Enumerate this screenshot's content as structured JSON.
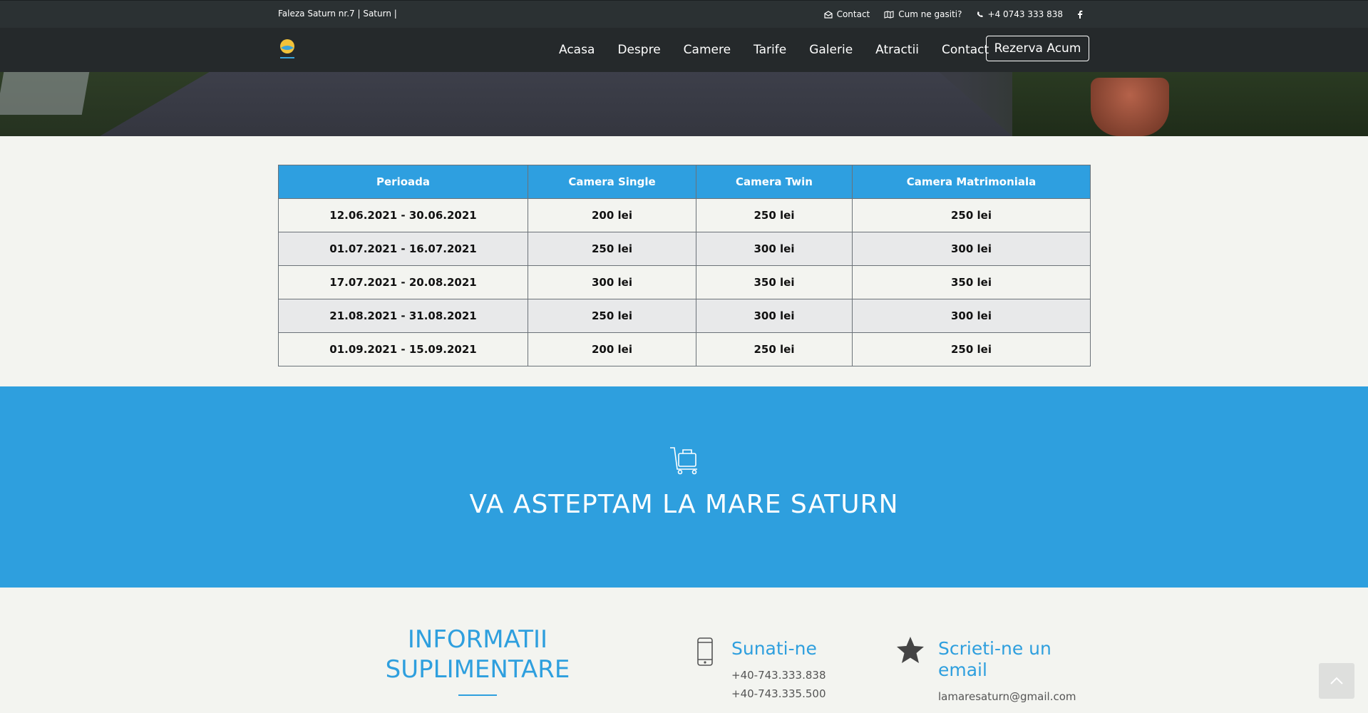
{
  "topbar": {
    "address": "Faleza Saturn nr.7 | Saturn |",
    "contact_label": "Contact",
    "directions_label": "Cum ne gasiti?",
    "phone_label": "+4 0743 333 838"
  },
  "nav": {
    "items": [
      "Acasa",
      "Despre",
      "Camere",
      "Tarife",
      "Galerie",
      "Atractii",
      "Contact"
    ],
    "book_label": "Rezerva Acum"
  },
  "prices": {
    "headers": [
      "Perioada",
      "Camera Single",
      "Camera Twin",
      "Camera Matrimoniala"
    ],
    "rows": [
      [
        "12.06.2021 - 30.06.2021",
        "200 lei",
        "250 lei",
        "250 lei"
      ],
      [
        "01.07.2021 - 16.07.2021",
        "250 lei",
        "300 lei",
        "300 lei"
      ],
      [
        "17.07.2021 - 20.08.2021",
        "300 lei",
        "350 lei",
        "350 lei"
      ],
      [
        "21.08.2021 - 31.08.2021",
        "250 lei",
        "300 lei",
        "300 lei"
      ],
      [
        "01.09.2021 - 15.09.2021",
        "200 lei",
        "250 lei",
        "250 lei"
      ]
    ]
  },
  "cta": {
    "title": "VA ASTEPTAM LA MARE SATURN",
    "icon": "luggage-cart-icon"
  },
  "info": {
    "headline_line1": "INFORMATII",
    "headline_line2": "SUPLIMENTARE",
    "call_title": "Sunati-ne",
    "phone1": "+40-743.333.838",
    "phone2": "+40-743.335.500",
    "mail_title": "Scrieti-ne un email",
    "email": "lamaresaturn@gmail.com"
  },
  "colors": {
    "accent": "#2e9fde",
    "topbar": "#2b3133",
    "navbar": "#25292b"
  }
}
